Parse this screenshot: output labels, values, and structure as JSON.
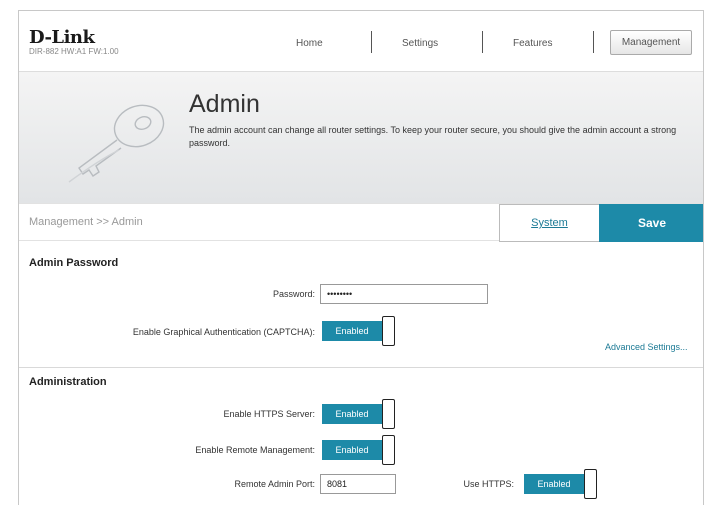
{
  "brand": {
    "name": "D-Link",
    "model": "DIR-882 HW:A1 FW:1.00"
  },
  "nav": {
    "home": "Home",
    "settings": "Settings",
    "features": "Features",
    "management": "Management"
  },
  "banner": {
    "title": "Admin",
    "description": "The admin account can change all router settings. To keep your router secure, you should give the admin account a strong password."
  },
  "breadcrumb": "Management >> Admin",
  "actions": {
    "system": "System",
    "save": "Save"
  },
  "admin_password": {
    "title": "Admin Password",
    "password_label": "Password:",
    "password_value": "••••••••",
    "captcha_label": "Enable Graphical Authentication (CAPTCHA):",
    "captcha_state": "Enabled",
    "advanced_link": "Advanced Settings..."
  },
  "administration": {
    "title": "Administration",
    "https_label": "Enable HTTPS Server:",
    "https_state": "Enabled",
    "remote_label": "Enable Remote Management:",
    "remote_state": "Enabled",
    "port_label": "Remote Admin Port:",
    "port_value": "8081",
    "use_https_label": "Use HTTPS:",
    "use_https_state": "Enabled"
  },
  "colors": {
    "accent": "#1d8aa8",
    "link": "#1c7a95"
  }
}
